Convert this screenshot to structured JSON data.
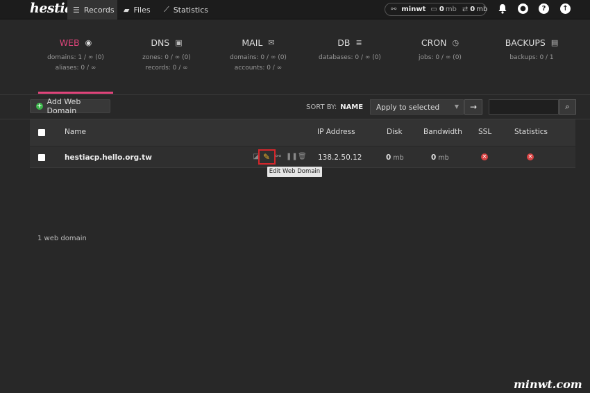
{
  "app": {
    "logo": "hestia"
  },
  "nav": [
    {
      "label": "Records",
      "icon": "list-icon"
    },
    {
      "label": "Files",
      "icon": "folder-icon"
    },
    {
      "label": "Statistics",
      "icon": "chart-icon"
    }
  ],
  "user": {
    "name": "minwt",
    "disk": "0",
    "disk_unit": "mb",
    "bandwidth": "0",
    "bandwidth_unit": "mb"
  },
  "services": [
    {
      "title": "WEB",
      "line1": "domains: 1 / ∞ (0)",
      "line2": "aliases: 0 / ∞",
      "icon": "globe-icon"
    },
    {
      "title": "DNS",
      "line1": "zones: 0 / ∞ (0)",
      "line2": "records: 0 / ∞",
      "icon": "book-icon"
    },
    {
      "title": "MAIL",
      "line1": "domains: 0 / ∞ (0)",
      "line2": "accounts: 0 / ∞",
      "icon": "mail-icon"
    },
    {
      "title": "DB",
      "line1": "databases: 0 / ∞ (0)",
      "line2": "",
      "icon": "database-icon"
    },
    {
      "title": "CRON",
      "line1": "jobs: 0 / ∞ (0)",
      "line2": "",
      "icon": "clock-icon"
    },
    {
      "title": "BACKUPS",
      "line1": "backups: 0 / 1",
      "line2": "",
      "icon": "file-icon"
    }
  ],
  "toolbar": {
    "add_label": "Add Web Domain",
    "sort_label": "SORT BY:",
    "sort_value": "NAME",
    "select_value": "Apply to selected"
  },
  "table": {
    "headers": {
      "name": "Name",
      "ip": "IP Address",
      "disk": "Disk",
      "bandwidth": "Bandwidth",
      "ssl": "SSL",
      "stats": "Statistics"
    },
    "rows": [
      {
        "domain": "hestiacp.hello.org.tw",
        "ip": "138.2.50.12",
        "disk": "0",
        "disk_unit": "mb",
        "bandwidth": "0",
        "bandwidth_unit": "mb"
      }
    ]
  },
  "tooltip": "Edit Web Domain",
  "footer": {
    "count": "1 web domain"
  },
  "watermark": "minwt.com",
  "colors": {
    "accent": "#e0457b",
    "success": "#3bb54a",
    "danger": "#d94444",
    "highlight": "#d6262b"
  }
}
